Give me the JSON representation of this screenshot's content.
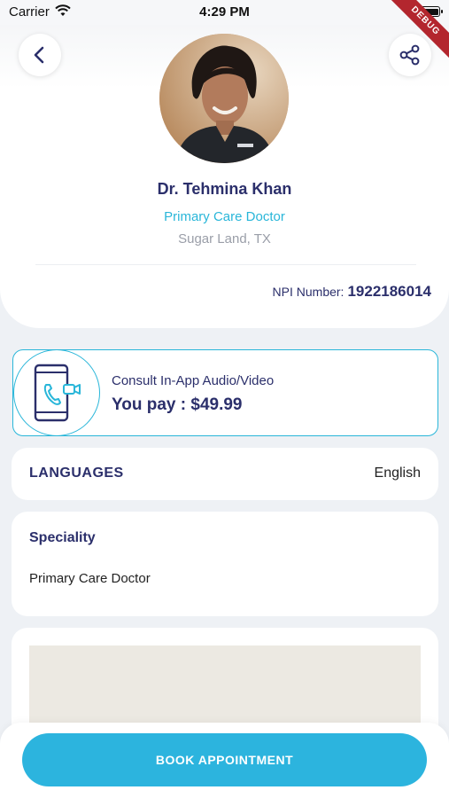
{
  "status_bar": {
    "carrier": "Carrier",
    "time": "4:29 PM",
    "wifi_icon": "wifi-icon",
    "battery_icon": "battery-icon"
  },
  "debug_banner": "DEBUG",
  "colors": {
    "primary_dark": "#2b2f6b",
    "accent": "#29b6d9",
    "button": "#2cb4de",
    "muted": "#9a9ea8",
    "background": "#eef1f5",
    "debug": "#b3262e"
  },
  "header": {
    "back_icon": "chevron-left-icon",
    "share_icon": "share-icon"
  },
  "doctor": {
    "name": "Dr. Tehmina Khan",
    "specialty": "Primary Care Doctor",
    "location": "Sugar Land, TX",
    "npi_label": "NPI Number:",
    "npi_value": "1922186014"
  },
  "consult": {
    "icon": "phone-video-call-icon",
    "title": "Consult In-App Audio/Video",
    "price": "You pay : $49.99"
  },
  "languages": {
    "label": "LANGUAGES",
    "value": "English"
  },
  "speciality": {
    "title": "Speciality",
    "value": "Primary Care Doctor"
  },
  "actions": {
    "book_label": "BOOK APPOINTMENT"
  }
}
